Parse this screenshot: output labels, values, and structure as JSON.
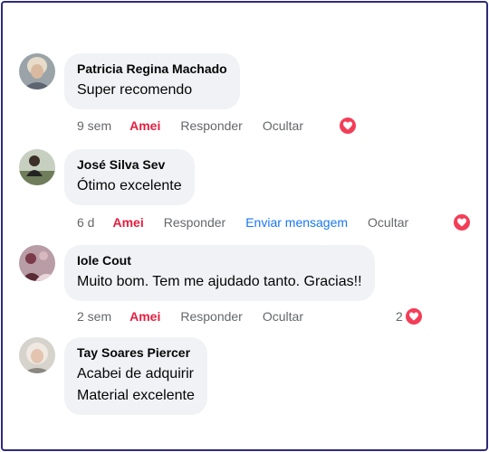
{
  "comments": [
    {
      "author": "Patricia Regina Machado",
      "lines": [
        "Super recomendo"
      ],
      "time": "9 sem",
      "reaction_label": "Amei",
      "reply_label": "Responder",
      "hide_label": "Ocultar",
      "reaction_count": "",
      "reaction_icon": "heart-icon"
    },
    {
      "author": "José Silva Sev",
      "lines": [
        "Ótimo excelente"
      ],
      "time": "6 d",
      "reaction_label": "Amei",
      "reply_label": "Responder",
      "send_message_label": "Enviar mensagem",
      "hide_label": "Ocultar",
      "reaction_count": "",
      "reaction_icon": "heart-icon"
    },
    {
      "author": "Iole Cout",
      "lines": [
        "Muito bom. Tem me ajudado tanto. Gracias!!"
      ],
      "time": "2 sem",
      "reaction_label": "Amei",
      "reply_label": "Responder",
      "hide_label": "Ocultar",
      "reaction_count": "2",
      "reaction_icon": "heart-icon"
    },
    {
      "author": "Tay Soares Piercer",
      "lines": [
        "Acabei de adquirir",
        "Material excelente"
      ]
    }
  ],
  "colors": {
    "loved": "#e41e3f",
    "link": "#1877f2",
    "meta": "#65676b",
    "bubble": "#f0f2f5",
    "heart": "#f33e58",
    "frame_border": "#2e2a78"
  }
}
